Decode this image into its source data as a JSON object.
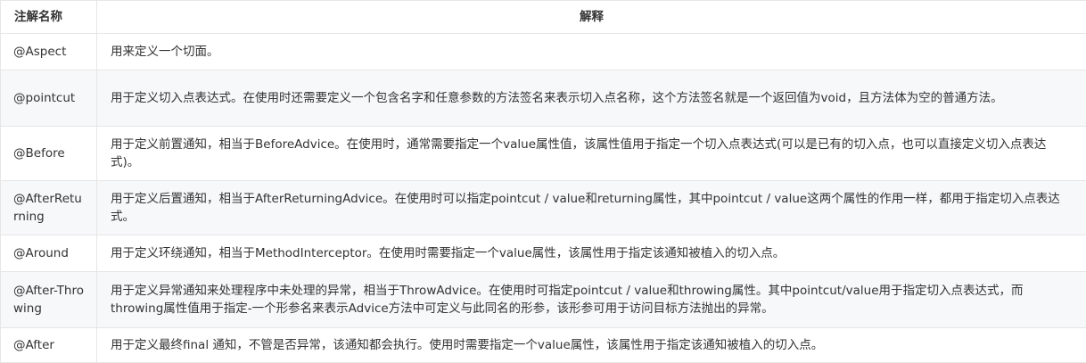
{
  "table": {
    "headers": [
      "注解名称",
      "解释"
    ],
    "rows": [
      {
        "name": "@Aspect",
        "desc": "用来定义一个切面。"
      },
      {
        "name": "@pointcut",
        "desc": "用于定义切入点表达式。在使用时还需要定义一个包含名字和任意参数的方法签名来表示切入点名称，这个方法签名就是一个返回值为void，且方法体为空的普通方法。"
      },
      {
        "name": "@Before",
        "desc": "用于定义前置通知，相当于BeforeAdvice。在使用时，通常需要指定一个value属性值，该属性值用于指定一个切入点表达式(可以是已有的切入点，也可以直接定义切入点表达式)。"
      },
      {
        "name": "@AfterReturning",
        "desc": "用于定义后置通知，相当于AfterReturningAdvice。在使用时可以指定pointcut / value和returning属性，其中pointcut / value这两个属性的作用一样，都用于指定切入点表达式。"
      },
      {
        "name": "@Around",
        "desc": "用于定义环绕通知，相当于MethodInterceptor。在使用时需要指定一个value属性，该属性用于指定该通知被植入的切入点。"
      },
      {
        "name": "@After-Throwing",
        "desc": "用于定义异常通知来处理程序中未处理的异常，相当于ThrowAdvice。在使用时可指定pointcut / value和throwing属性。其中pointcut/value用于指定切入点表达式，而throwing属性值用于指定-一个形参名来表示Advice方法中可定义与此同名的形参，该形参可用于访问目标方法抛出的异常。"
      },
      {
        "name": "@After",
        "desc": "用于定义最终final 通知，不管是否异常，该通知都会执行。使用时需要指定一个value属性，该属性用于指定该通知被植入的切入点。"
      }
    ]
  }
}
